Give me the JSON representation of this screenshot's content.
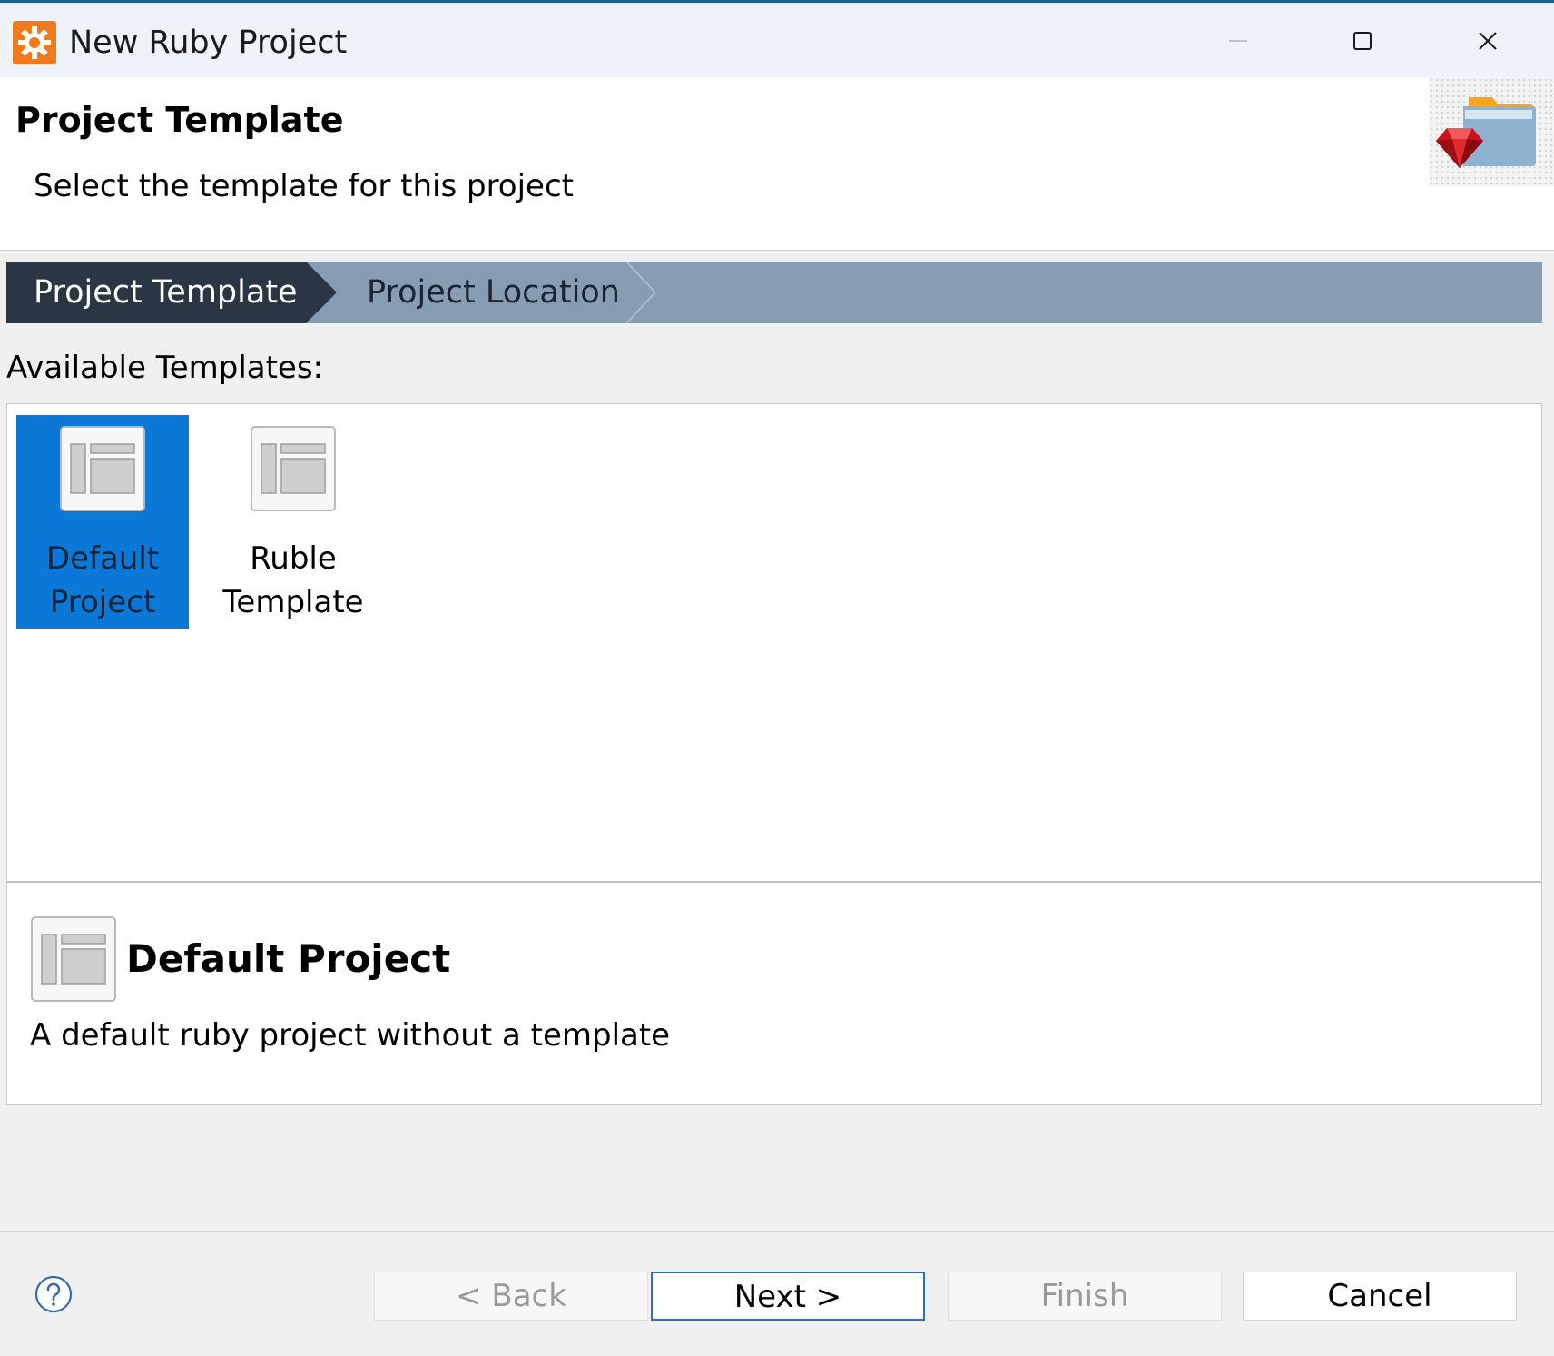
{
  "window": {
    "title": "New Ruby Project",
    "icon": "gear-icon",
    "controls": [
      "minimize-icon",
      "maximize-icon",
      "close-icon"
    ]
  },
  "banner": {
    "title": "Project Template",
    "subtitle": "Select the template for this project",
    "icon": "ruby-folder-icon"
  },
  "steps": [
    {
      "label": "Project Template",
      "active": true
    },
    {
      "label": "Project Location",
      "active": false
    }
  ],
  "templates": {
    "label": "Available Templates:",
    "items": [
      {
        "label": "Default Project",
        "selected": true,
        "icon": "template-icon"
      },
      {
        "label": "Ruble Template",
        "selected": false,
        "icon": "template-icon"
      }
    ]
  },
  "description": {
    "title": "Default Project",
    "text": "A default ruby project without a template",
    "icon": "template-icon"
  },
  "footer": {
    "help_icon": "help-icon",
    "buttons": {
      "back": "< Back",
      "next": "Next >",
      "finish": "Finish",
      "cancel": "Cancel"
    },
    "disabled": [
      "back",
      "finish"
    ]
  },
  "colors": {
    "selection": "#0a78d7",
    "step_active": "#2a3644",
    "step_bar": "#879db3",
    "default_button_border": "#2a6fc0"
  }
}
